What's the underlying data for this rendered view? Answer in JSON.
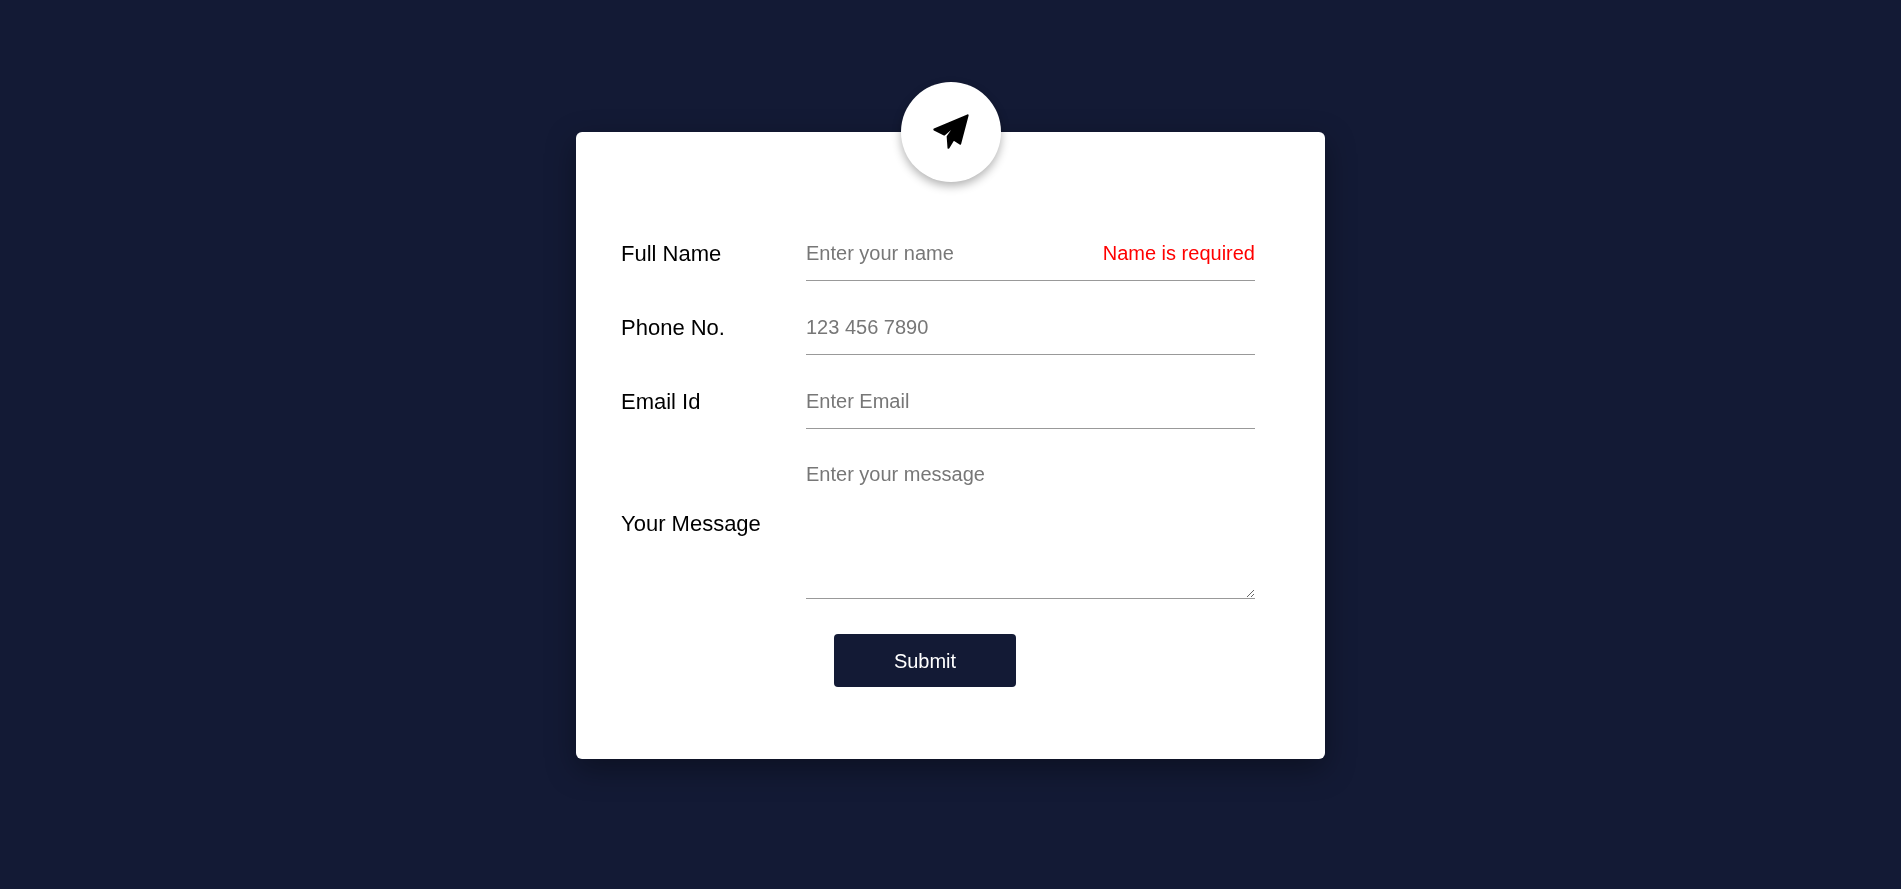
{
  "fields": [
    {
      "kind": "input",
      "label": "Full Name",
      "placeholder": "Enter your name",
      "error": "Name is required"
    },
    {
      "kind": "input",
      "label": "Phone No.",
      "placeholder": "123 456 7890"
    },
    {
      "kind": "input",
      "label": "Email Id",
      "placeholder": "Enter Email"
    },
    {
      "kind": "textarea",
      "label": "Your Message",
      "placeholder": "Enter your message"
    }
  ],
  "submit": "Submit"
}
